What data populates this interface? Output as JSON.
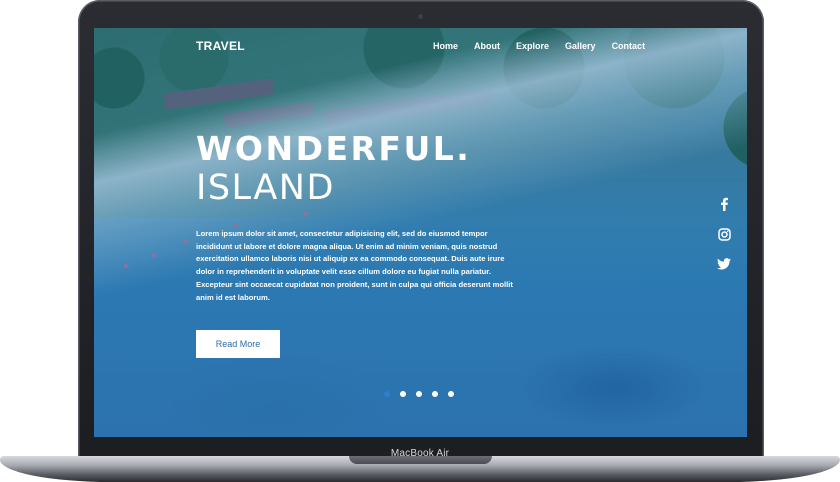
{
  "device": {
    "label": "MacBook Air"
  },
  "nav": {
    "brand": "TRAVEL",
    "links": [
      "Home",
      "About",
      "Explore",
      "Gallery",
      "Contact"
    ]
  },
  "hero": {
    "title_line1": "WONDERFUL.",
    "title_line2": "ISLAND",
    "paragraph": "Lorem ipsum dolor sit amet, consectetur adipisicing elit, sed do eiusmod tempor incididunt ut labore et dolore magna aliqua. Ut enim ad minim veniam, quis nostrud exercitation ullamco laboris nisi ut aliquip ex ea commodo consequat. Duis aute irure dolor in reprehenderit in voluptate velit esse cillum dolore eu fugiat nulla pariatur. Excepteur sint occaecat cupidatat non proident, sunt in culpa qui officia deserunt mollit anim id est laborum.",
    "button_label": "Read More"
  },
  "social": {
    "icons": [
      "facebook-icon",
      "instagram-icon",
      "twitter-icon"
    ]
  },
  "slider": {
    "total": 5,
    "active_index": 0,
    "active_color": "#2f7fd0"
  },
  "colors": {
    "accent": "#2c6aa8",
    "text_on_image": "#ffffff"
  }
}
